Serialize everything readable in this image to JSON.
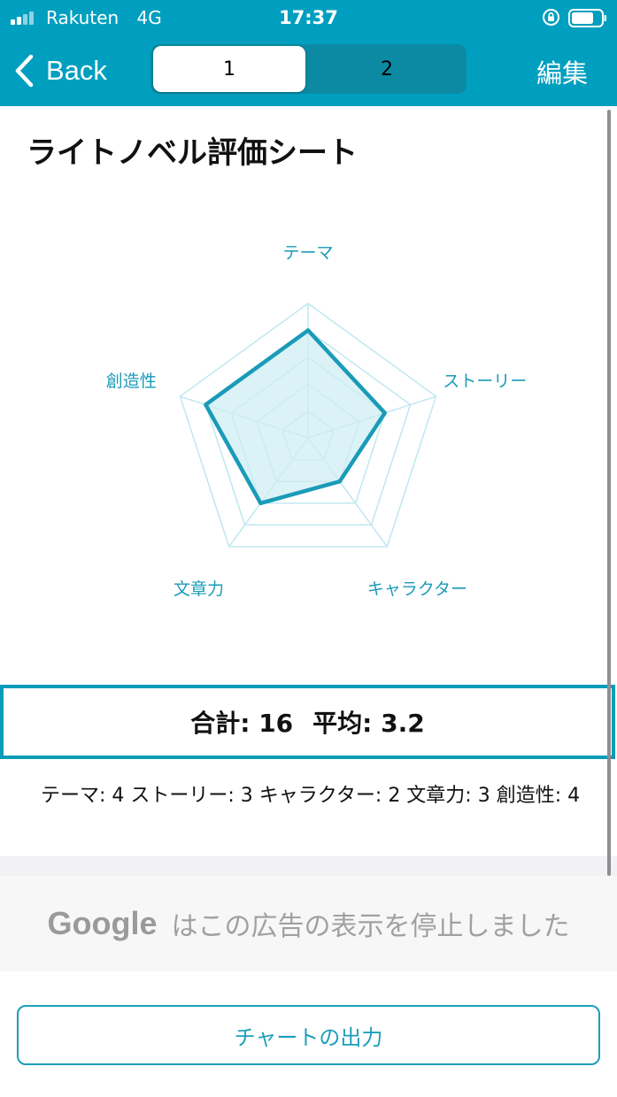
{
  "status": {
    "carrier": "Rakuten",
    "network": "4G",
    "time": "17:37"
  },
  "nav": {
    "back_label": "Back",
    "segments": [
      "1",
      "2"
    ],
    "edit_label": "編集"
  },
  "sheet": {
    "title": "ライトノベル評価シート"
  },
  "chart_data": {
    "type": "radar",
    "categories": [
      "テーマ",
      "ストーリー",
      "キャラクター",
      "文章力",
      "創造性"
    ],
    "values": [
      4,
      3,
      2,
      3,
      4
    ],
    "rmax": 5,
    "grid_levels": 5,
    "colors": {
      "line": "#1a9bb8",
      "fill": "#cfeef3",
      "grid": "#bfe8f0"
    }
  },
  "summary": {
    "total": "合計: 16",
    "average": "平均: 3.2"
  },
  "detail": "テーマ: 4  ストーリー: 3  キャラクター: 2  文章力: 3  創造性: 4",
  "ad": {
    "brand": "Google",
    "message": "はこの広告の表示を停止しました"
  },
  "export_label": "チャートの出力"
}
